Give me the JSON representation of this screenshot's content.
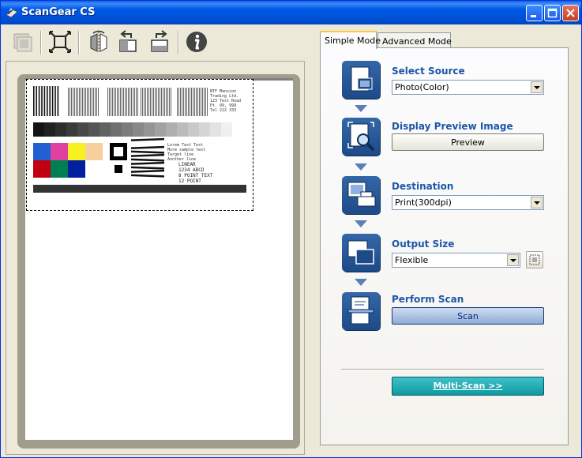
{
  "window": {
    "title": "ScanGear CS"
  },
  "toolbar": {
    "icons": [
      "thumbnail-icon",
      "auto-crop-icon",
      "mirror-icon",
      "rotate-left-icon",
      "rotate-right-icon",
      "info-icon"
    ]
  },
  "tabs": [
    {
      "label": "Simple Mode",
      "active": true
    },
    {
      "label": "Advanced Mode",
      "active": false
    }
  ],
  "steps": {
    "source": {
      "label": "Select Source",
      "value": "Photo(Color)"
    },
    "preview": {
      "label": "Display Preview Image",
      "button": "Preview"
    },
    "destination": {
      "label": "Destination",
      "value": "Print(300dpi)"
    },
    "output": {
      "label": "Output Size",
      "value": "Flexible"
    },
    "scan": {
      "label": "Perform Scan",
      "button": "Scan"
    }
  },
  "multiscan": {
    "button": "Multi-Scan >>"
  },
  "target": {
    "text_block1": [
      "NTF Mansion",
      "Trading Ltd.",
      "123 Test Road",
      "Pt. 99, 999",
      "Tel 222 333"
    ],
    "text_block2": [
      "Lorem Test Text",
      "More sample text",
      "Target line",
      "Another line"
    ],
    "text_block3": [
      "LINEAR",
      "1234 ABCD",
      "8 POINT TEXT",
      "12 POINT"
    ]
  },
  "colors": {
    "titlebar": "#0054e3",
    "accent": "#1c56a8",
    "multiscan": "#17a4ac",
    "swatches": [
      "#2060d0",
      "#e040a0",
      "#f8f020",
      "#f8d0a0",
      "#c00010",
      "#008050",
      "#0020a0"
    ]
  }
}
